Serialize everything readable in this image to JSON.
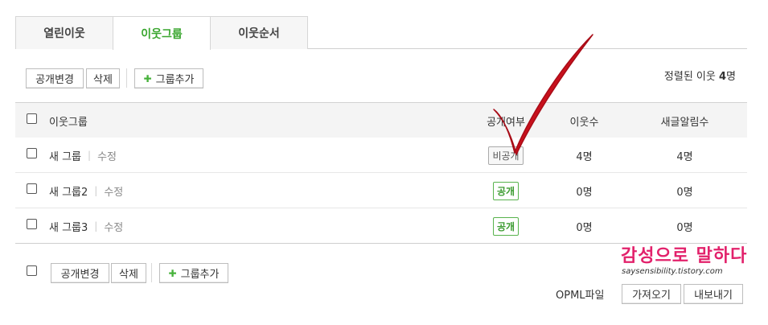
{
  "tabs": [
    {
      "label": "열린이웃"
    },
    {
      "label": "이웃그룹"
    },
    {
      "label": "이웃순서"
    }
  ],
  "toolbar_top": {
    "change_public": "공개변경",
    "delete": "삭제",
    "add_group": "그룹추가"
  },
  "sorted": {
    "prefix": "정렬된 이웃",
    "count": "4",
    "unit": "명"
  },
  "table": {
    "headers": {
      "name": "이웃그룹",
      "public": "공개여부",
      "count": "이웃수",
      "new_alert": "새글알림수"
    },
    "edit_label": "수정",
    "rows": [
      {
        "name": "새 그룹",
        "public": "비공개",
        "count": "4명",
        "new_alert": "4명"
      },
      {
        "name": "새 그룹2",
        "public": "공개",
        "count": "0명",
        "new_alert": "0명"
      },
      {
        "name": "새 그룹3",
        "public": "공개",
        "count": "0명",
        "new_alert": "0명"
      }
    ]
  },
  "toolbar_bottom": {
    "change_public": "공개변경",
    "delete": "삭제",
    "add_group": "그룹추가"
  },
  "opml": {
    "label": "OPML파일",
    "import": "가져오기",
    "export": "내보내기"
  },
  "watermark": {
    "title": "감성으로 말하다",
    "url": "saysensibility.tistory.com"
  },
  "colors": {
    "accent_green": "#3aa62f",
    "annotation_red": "#c8101c",
    "watermark_pink": "#e2216b"
  }
}
